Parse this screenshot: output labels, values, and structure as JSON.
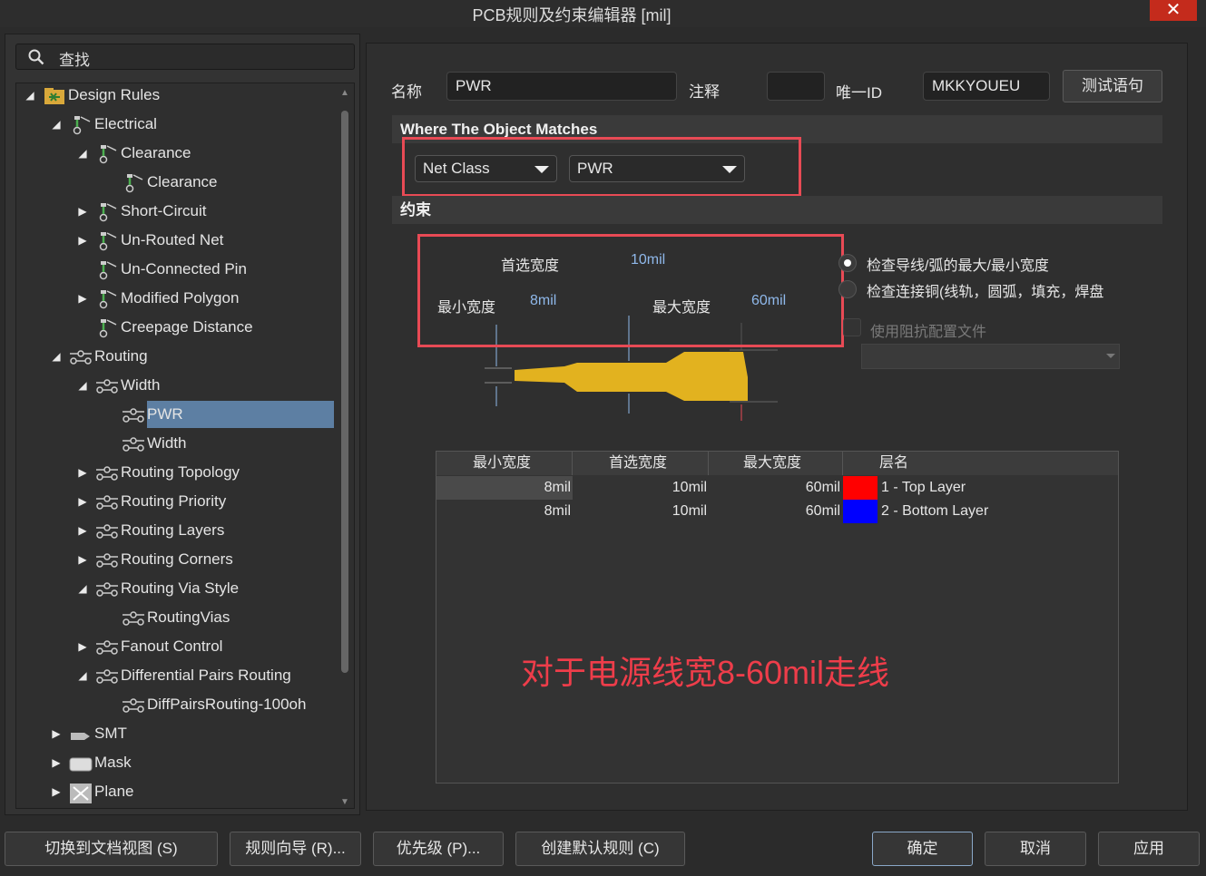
{
  "window": {
    "title": "PCB规则及约束编辑器 [mil]",
    "close_label": "✕"
  },
  "search": {
    "placeholder": "查找"
  },
  "tree": {
    "items": [
      {
        "label": "Design Rules",
        "arrow": "◢",
        "icon": "design-rules-icon"
      },
      {
        "label": "Electrical",
        "arrow": "◢",
        "icon": "electrical-icon"
      },
      {
        "label": "Clearance",
        "arrow": "◢",
        "icon": "electrical-icon"
      },
      {
        "label": "Clearance",
        "arrow": "",
        "icon": "electrical-icon"
      },
      {
        "label": "Short-Circuit",
        "arrow": "▶",
        "icon": "electrical-icon"
      },
      {
        "label": "Un-Routed Net",
        "arrow": "▶",
        "icon": "electrical-icon"
      },
      {
        "label": "Un-Connected Pin",
        "arrow": "",
        "icon": "electrical-icon"
      },
      {
        "label": "Modified Polygon",
        "arrow": "▶",
        "icon": "electrical-icon"
      },
      {
        "label": "Creepage Distance",
        "arrow": "",
        "icon": "electrical-icon"
      },
      {
        "label": "Routing",
        "arrow": "◢",
        "icon": "routing-icon"
      },
      {
        "label": "Width",
        "arrow": "◢",
        "icon": "routing-icon"
      },
      {
        "label": "PWR",
        "arrow": "",
        "icon": "routing-icon"
      },
      {
        "label": "Width",
        "arrow": "",
        "icon": "routing-icon"
      },
      {
        "label": "Routing Topology",
        "arrow": "▶",
        "icon": "routing-icon"
      },
      {
        "label": "Routing Priority",
        "arrow": "▶",
        "icon": "routing-icon"
      },
      {
        "label": "Routing Layers",
        "arrow": "▶",
        "icon": "routing-icon"
      },
      {
        "label": "Routing Corners",
        "arrow": "▶",
        "icon": "routing-icon"
      },
      {
        "label": "Routing Via Style",
        "arrow": "◢",
        "icon": "routing-icon"
      },
      {
        "label": "RoutingVias",
        "arrow": "",
        "icon": "routing-icon"
      },
      {
        "label": "Fanout Control",
        "arrow": "▶",
        "icon": "routing-icon"
      },
      {
        "label": "Differential Pairs Routing",
        "arrow": "◢",
        "icon": "routing-icon"
      },
      {
        "label": "DiffPairsRouting-100oh",
        "arrow": "",
        "icon": "routing-icon"
      },
      {
        "label": "SMT",
        "arrow": "▶",
        "icon": "smt-icon"
      },
      {
        "label": "Mask",
        "arrow": "▶",
        "icon": "mask-icon"
      },
      {
        "label": "Plane",
        "arrow": "▶",
        "icon": "plane-icon"
      }
    ]
  },
  "rule": {
    "name_label": "名称",
    "name_value": "PWR",
    "comment_label": "注释",
    "comment_value": "",
    "uid_label": "唯一ID",
    "uid_value": "MKKYOUEU",
    "test_button": "测试语句"
  },
  "match": {
    "heading": "Where The Object Matches",
    "type_value": "Net Class",
    "target_value": "PWR"
  },
  "constraints": {
    "heading": "约束",
    "preferred_label": "首选宽度",
    "preferred_value": "10mil",
    "min_label": "最小宽度",
    "min_value": "8mil",
    "max_label": "最大宽度",
    "max_value": "60mil",
    "radio_max_min": "检查导线/弧的最大/最小宽度",
    "radio_copper": "检查连接铜(线轨，圆弧，填充，焊盘",
    "impedance_checkbox": "使用阻抗配置文件",
    "impedance_profile_value": ""
  },
  "layer_table": {
    "headers": [
      "最小宽度",
      "首选宽度",
      "最大宽度",
      "层名"
    ],
    "rows": [
      {
        "min": "8mil",
        "preferred": "10mil",
        "max": "60mil",
        "color": "#ff0000",
        "layer": "1 - Top Layer"
      },
      {
        "min": "8mil",
        "preferred": "10mil",
        "max": "60mil",
        "color": "#0000ff",
        "layer": "2 - Bottom Layer"
      }
    ]
  },
  "annotation": "对于电源线宽8-60mil走线",
  "bottom": {
    "switch_doc_view": "切换到文档视图 (S)",
    "rule_wizard": "规则向导 (R)...",
    "priorities": "优先级 (P)...",
    "create_default": "创建默认规则 (C)",
    "ok": "确定",
    "cancel": "取消",
    "apply": "应用"
  },
  "colors": {
    "accent_red": "#e84a55",
    "selection": "#5d7fa3",
    "trace_fill": "#e2b21f"
  }
}
